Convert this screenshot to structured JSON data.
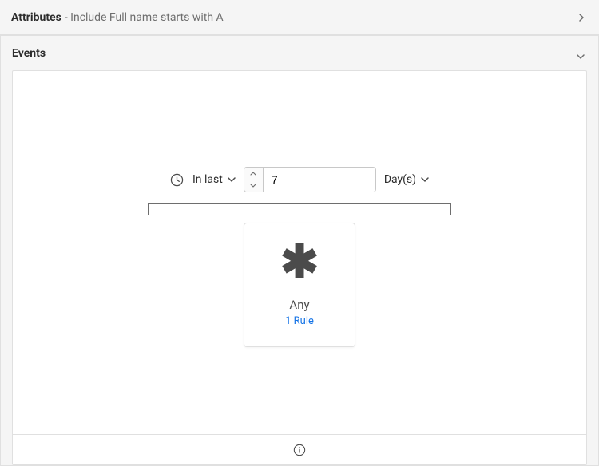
{
  "attributes_header": {
    "title": "Attributes",
    "subtitle": " - Include Full name starts with A"
  },
  "events_header": {
    "title": "Events"
  },
  "time_filter": {
    "range_label": "In last",
    "value": "7",
    "unit_label": "Day(s)"
  },
  "event_card": {
    "title": "Any",
    "rule_text": "1 Rule"
  }
}
